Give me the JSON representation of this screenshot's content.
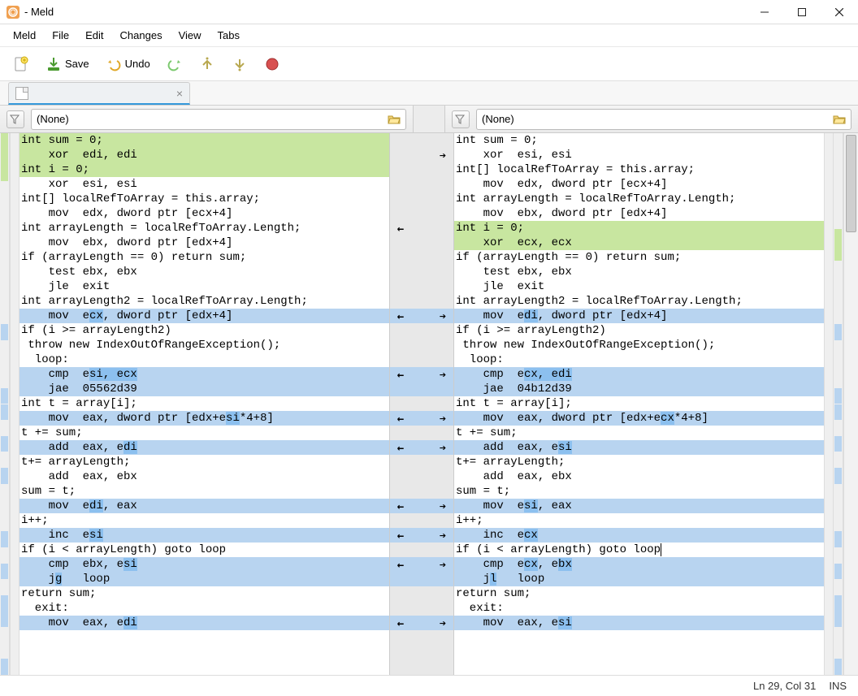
{
  "window": {
    "title": " - Meld"
  },
  "menubar": [
    "Meld",
    "File",
    "Edit",
    "Changes",
    "View",
    "Tabs"
  ],
  "toolbar": {
    "save": "Save",
    "undo": "Undo"
  },
  "file_selectors": {
    "left": "(None)",
    "right": "(None)"
  },
  "status": {
    "pos": "Ln 29, Col 31",
    "mode": "INS"
  },
  "left_lines": [
    {
      "t": "int sum = 0;",
      "bg": "green"
    },
    {
      "t": "    xor  edi, edi",
      "bg": "green"
    },
    {
      "t": "int i = 0;",
      "bg": "green"
    },
    {
      "t": "    xor  esi, esi"
    },
    {
      "t": "int[] localRefToArray = this.array;"
    },
    {
      "t": "    mov  edx, dword ptr [ecx+4]"
    },
    {
      "t": "int arrayLength = localRefToArray.Length;"
    },
    {
      "t": "    mov  ebx, dword ptr [edx+4]"
    },
    {
      "t": "if (arrayLength == 0) return sum;"
    },
    {
      "t": "    test ebx, ebx"
    },
    {
      "t": "    jle  exit"
    },
    {
      "t": "int arrayLength2 = localRefToArray.Length;"
    },
    {
      "t": "    mov  e",
      "bg": "blue",
      "tail": ", dword ptr [edx+4]",
      "mid": "cx"
    },
    {
      "t": "if (i >= arrayLength2)"
    },
    {
      "t": " throw new IndexOutOfRangeException();"
    },
    {
      "t": "  loop:"
    },
    {
      "t": "    cmp  e",
      "bg": "blue",
      "mid": "si, ecx",
      "tail": ""
    },
    {
      "t": "    jae  05562d39",
      "bg": "blue"
    },
    {
      "t": "int t = array[i];"
    },
    {
      "t": "    mov  eax, dword ptr [edx+e",
      "bg": "blue",
      "mid": "si",
      "tail": "*4+8]"
    },
    {
      "t": "t += sum;"
    },
    {
      "t": "    add  eax, e",
      "bg": "blue",
      "mid": "di",
      "tail": ""
    },
    {
      "t": "t+= arrayLength;"
    },
    {
      "t": "    add  eax, ebx"
    },
    {
      "t": "sum = t;"
    },
    {
      "t": "    mov  e",
      "bg": "blue",
      "mid": "di",
      "tail": ", eax"
    },
    {
      "t": "i++;"
    },
    {
      "t": "    inc  e",
      "bg": "blue",
      "mid": "si",
      "tail": ""
    },
    {
      "t": "if (i < arrayLength) goto loop"
    },
    {
      "t": "    cmp  ebx, e",
      "bg": "blue",
      "mid": "si",
      "tail": ""
    },
    {
      "t": "    j",
      "bg": "blue",
      "mid": "g",
      "tail": "   loop"
    },
    {
      "t": "return sum;"
    },
    {
      "t": "  exit:"
    },
    {
      "t": "    mov  eax, e",
      "bg": "blue",
      "mid": "di",
      "tail": ""
    }
  ],
  "right_lines": [
    {
      "t": "int sum = 0;"
    },
    {
      "t": "    xor  esi, esi"
    },
    {
      "t": "int[] localRefToArray = this.array;"
    },
    {
      "t": "    mov  edx, dword ptr [ecx+4]"
    },
    {
      "t": "int arrayLength = localRefToArray.Length;"
    },
    {
      "t": "    mov  ebx, dword ptr [edx+4]"
    },
    {
      "t": "int i = 0;",
      "bg": "green"
    },
    {
      "t": "    xor  ecx, ecx",
      "bg": "green"
    },
    {
      "t": "if (arrayLength == 0) return sum;"
    },
    {
      "t": "    test ebx, ebx"
    },
    {
      "t": "    jle  exit"
    },
    {
      "t": "int arrayLength2 = localRefToArray.Length;"
    },
    {
      "t": "    mov  e",
      "bg": "blue",
      "mid": "di",
      "tail": ", dword ptr [edx+4]"
    },
    {
      "t": "if (i >= arrayLength2)"
    },
    {
      "t": " throw new IndexOutOfRangeException();"
    },
    {
      "t": "  loop:"
    },
    {
      "t": "    cmp  e",
      "bg": "blue",
      "mid": "cx, edi",
      "tail": ""
    },
    {
      "t": "    jae  04b12d39",
      "bg": "blue"
    },
    {
      "t": "int t = array[i];"
    },
    {
      "t": "    mov  eax, dword ptr [edx+e",
      "bg": "blue",
      "mid": "cx",
      "tail": "*4+8]"
    },
    {
      "t": "t += sum;"
    },
    {
      "t": "    add  eax, e",
      "bg": "blue",
      "mid": "si",
      "tail": ""
    },
    {
      "t": "t+= arrayLength;"
    },
    {
      "t": "    add  eax, ebx"
    },
    {
      "t": "sum = t;"
    },
    {
      "t": "    mov  e",
      "bg": "blue",
      "mid": "si",
      "tail": ", eax"
    },
    {
      "t": "i++;"
    },
    {
      "t": "    inc  e",
      "bg": "blue",
      "mid": "cx",
      "tail": ""
    },
    {
      "t": "if (i < arrayLength) goto loop",
      "cursor": true
    },
    {
      "t": "    cmp  e",
      "bg": "blue",
      "mid": "cx",
      "tail": ", e",
      "mid2": "bx",
      "tail2": ""
    },
    {
      "t": "    j",
      "bg": "blue",
      "mid": "l",
      "tail": "   loop"
    },
    {
      "t": "return sum;"
    },
    {
      "t": "  exit:"
    },
    {
      "t": "    mov  eax, e",
      "bg": "blue",
      "mid": "si",
      "tail": ""
    }
  ],
  "center_arrows": [
    {
      "row": 1,
      "side": "r"
    },
    {
      "row": 6,
      "side": "l"
    },
    {
      "row": 12,
      "side": "both"
    },
    {
      "row": 16,
      "side": "both"
    },
    {
      "row": 19,
      "side": "both"
    },
    {
      "row": 21,
      "side": "both"
    },
    {
      "row": 25,
      "side": "both"
    },
    {
      "row": 27,
      "side": "both"
    },
    {
      "row": 29,
      "side": "both"
    },
    {
      "row": 33,
      "side": "both"
    }
  ],
  "chart_data": null
}
